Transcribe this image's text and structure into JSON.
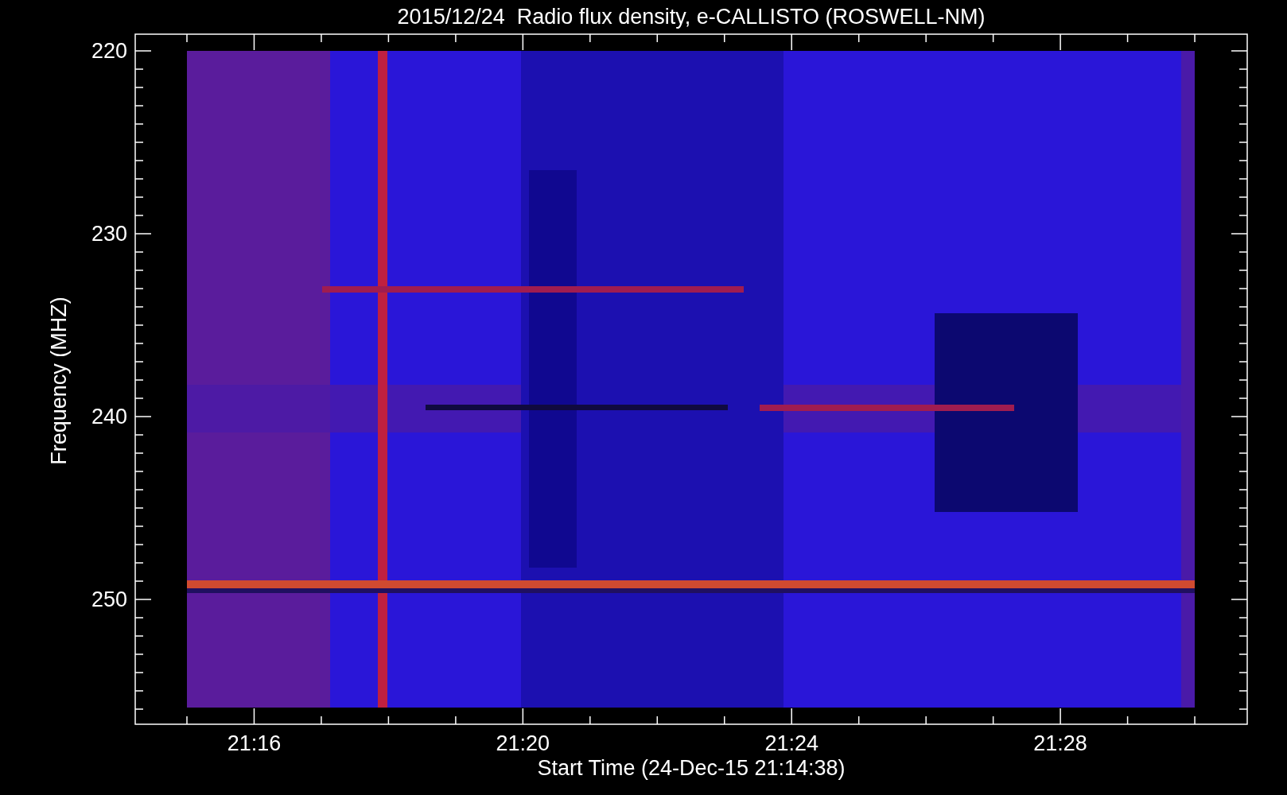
{
  "title": "2015/12/24  Radio flux density, e-CALLISTO (ROSWELL-NM)",
  "y_axis": {
    "label": "Frequency (MHZ)",
    "ticks": [
      "220",
      "230",
      "240",
      "250"
    ]
  },
  "x_axis": {
    "label": "Start Time (24-Dec-15 21:14:38)",
    "ticks": [
      "21:16",
      "21:20",
      "21:24",
      "21:28"
    ]
  }
}
